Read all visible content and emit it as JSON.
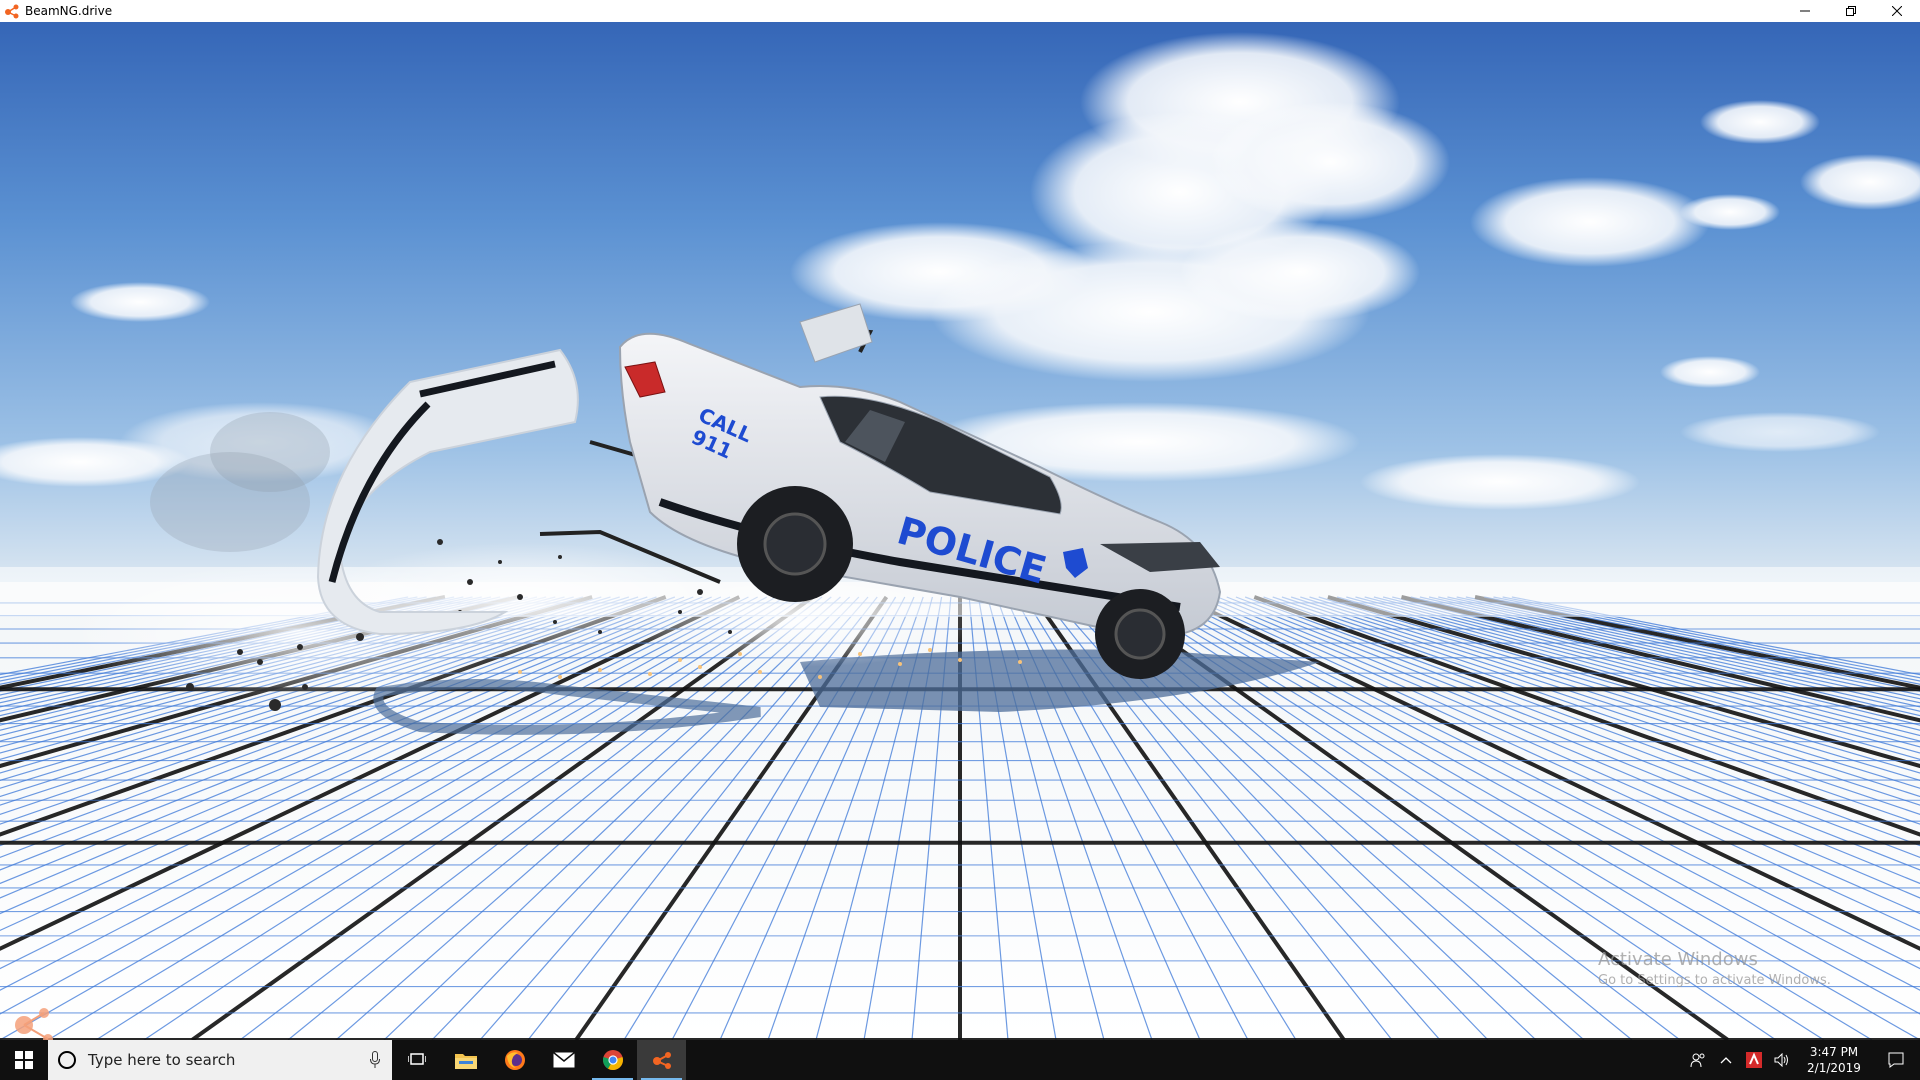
{
  "window": {
    "title": "BeamNG.drive",
    "controls": {
      "minimize": "minimize-icon",
      "restore": "restore-icon",
      "close": "close-icon"
    }
  },
  "scene": {
    "car_decal_main": "POLICE",
    "car_decal_call": "CALL",
    "car_decal_number": "911"
  },
  "watermark": {
    "title": "Activate Windows",
    "subtitle": "Go to Settings to activate Windows."
  },
  "taskbar": {
    "search_placeholder": "Type here to search",
    "apps": [
      {
        "name": "task-view",
        "icon": "task-view-icon"
      },
      {
        "name": "file-explorer",
        "icon": "folder-icon"
      },
      {
        "name": "firefox",
        "icon": "firefox-icon"
      },
      {
        "name": "mail",
        "icon": "mail-icon"
      },
      {
        "name": "chrome",
        "icon": "chrome-icon"
      },
      {
        "name": "beamng",
        "icon": "beamng-icon"
      }
    ],
    "clock": {
      "time": "3:47 PM",
      "date": "2/1/2019"
    }
  },
  "colors": {
    "sky_top": "#3b73c4",
    "sky_bottom": "#b9d4ec",
    "grid_line": "#3c78d8",
    "taskbar_bg": "#101010",
    "beamng_orange": "#f26522"
  }
}
